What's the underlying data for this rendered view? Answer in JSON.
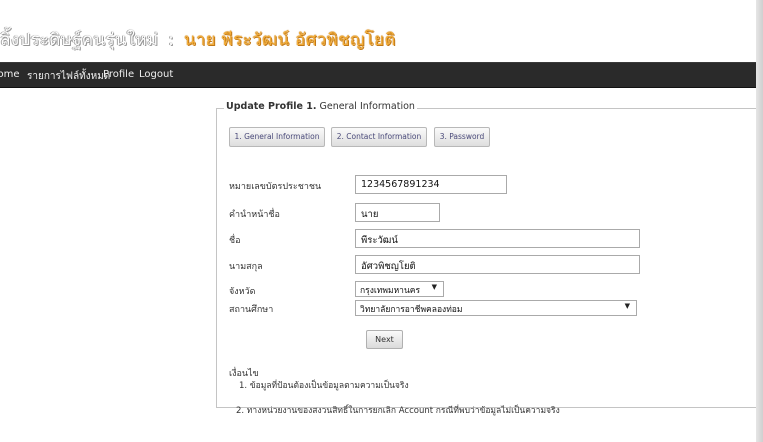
{
  "header": {
    "site_title": "ลิ้งประดิษฐ์คนรุ่นใหม่",
    "separator": ":",
    "user_name": "นาย พีระวัฒน์ อัศวพิชญโยติ"
  },
  "nav": {
    "items": [
      {
        "label": "Home"
      },
      {
        "label": "รายการไฟล์ทั้งหมด"
      },
      {
        "label": "Profile"
      },
      {
        "label": "Logout"
      }
    ]
  },
  "form": {
    "legend_title": "Update Profile 1.",
    "legend_rest": " General Information",
    "tabs": [
      {
        "label": "1. General Information"
      },
      {
        "label": "2. Contact Information"
      },
      {
        "label": "3. Password"
      }
    ],
    "fields": {
      "citizen_id": {
        "label": "หมายเลขบัตรประชาชน",
        "value": "1234567891234"
      },
      "prefix": {
        "label": "คำนำหน้าชื่อ",
        "value": "นาย"
      },
      "first_name": {
        "label": "ชื่อ",
        "value": "พีระวัฒน์"
      },
      "last_name": {
        "label": "นามสกุล",
        "value": "อัศวพิชญโยติ"
      },
      "province": {
        "label": "จังหวัด",
        "value": "กรุงเทพมหานคร"
      },
      "school": {
        "label": "สถานศึกษา",
        "value": "วิทยาลัยการอาชีพคลองท่อม"
      }
    },
    "next_label": "Next"
  },
  "notes": {
    "title": "เงื่อนไข",
    "items": [
      "1. ข้อมูลที่ป้อนต้องเป็นข้อมูลตามความเป็นจริง",
      "2. ทางหน่วยงานของสงวนสิทธิ์ในการยกเลิก Account กรณีที่พบว่าข้อมูลไม่เป็นความจริง"
    ]
  }
}
